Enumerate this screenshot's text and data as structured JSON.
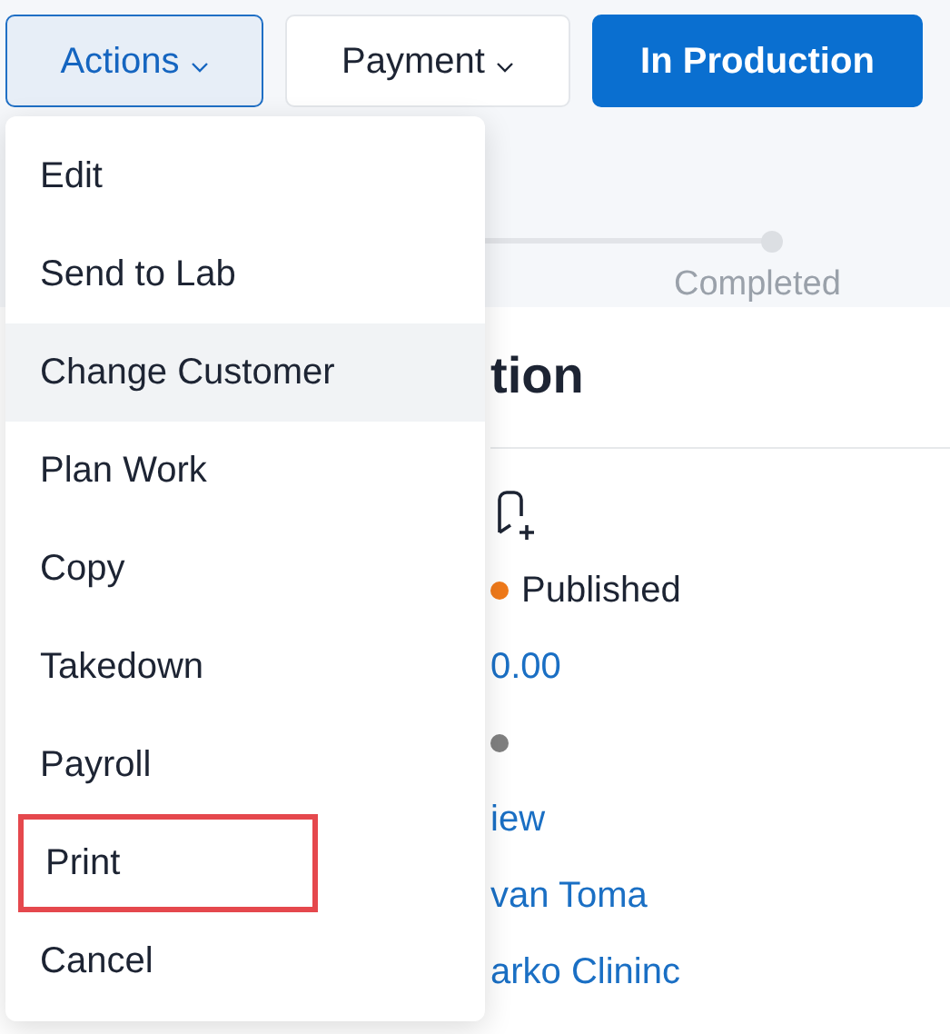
{
  "toolbar": {
    "buttons": [
      {
        "label": "Actions",
        "kind": "dropdown",
        "selected": true
      },
      {
        "label": "Payment",
        "kind": "dropdown",
        "selected": false
      },
      {
        "label": "In Production",
        "kind": "primary",
        "selected": false
      }
    ]
  },
  "progress": {
    "step_label": "Completed"
  },
  "panel": {
    "title": "tion",
    "rows": [
      {
        "kind": "icon"
      },
      {
        "kind": "status",
        "text": "Published",
        "color": "#f07a1a"
      },
      {
        "kind": "link",
        "text": "0.00"
      },
      {
        "kind": "status",
        "text": "",
        "color": "#808080"
      },
      {
        "kind": "link",
        "text": "iew"
      },
      {
        "kind": "link",
        "text": "van Toma"
      },
      {
        "kind": "link",
        "text": "arko Clininc"
      }
    ]
  },
  "menu": {
    "items": [
      {
        "label": "Edit",
        "selected": false,
        "outlined": false
      },
      {
        "label": "Send to Lab",
        "selected": false,
        "outlined": false
      },
      {
        "label": "Change Customer",
        "selected": true,
        "outlined": false
      },
      {
        "label": "Plan Work",
        "selected": false,
        "outlined": false
      },
      {
        "label": "Copy",
        "selected": false,
        "outlined": false
      },
      {
        "label": "Takedown",
        "selected": false,
        "outlined": false
      },
      {
        "label": "Payroll",
        "selected": false,
        "outlined": false
      },
      {
        "label": "Print",
        "selected": false,
        "outlined": true
      },
      {
        "label": "Cancel",
        "selected": false,
        "outlined": false
      }
    ]
  }
}
